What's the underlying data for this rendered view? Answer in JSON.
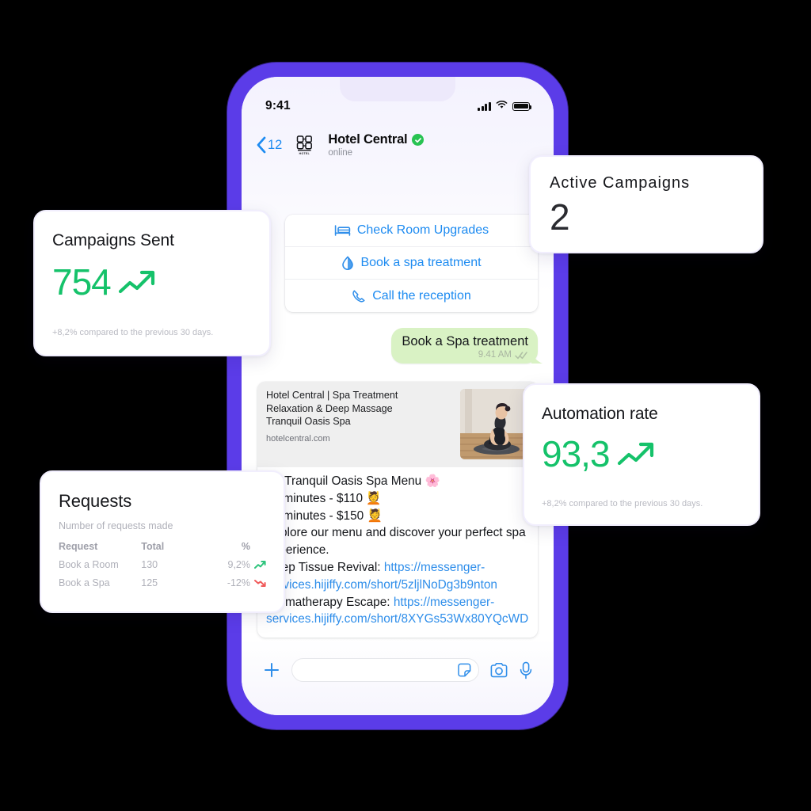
{
  "phone": {
    "statusbar": {
      "time": "9:41",
      "signal_icon": "cellular-bars-icon",
      "wifi_icon": "wifi-icon",
      "battery_icon": "battery-icon"
    },
    "header": {
      "back_icon": "chevron-left-icon",
      "back_count": "12",
      "avatar_icon": "hotel-logo-icon",
      "avatar_word": "HOTEL",
      "peer_name": "Hotel Central",
      "verified_icon": "verified-check-icon",
      "status": "online"
    },
    "quick_replies": [
      {
        "icon": "bed-icon",
        "label": "Check Room Upgrades"
      },
      {
        "icon": "water-drop-icon",
        "label": "Book a spa treatment"
      },
      {
        "icon": "phone-call-icon",
        "label": "Call the reception"
      }
    ],
    "outgoing_message": {
      "text": "Book a Spa treatment",
      "time": "9.41 AM",
      "read_receipt_icon": "double-check-icon",
      "bubble_color": "#D9F2C4"
    },
    "incoming_message": {
      "link_preview": {
        "title_lines": [
          "Hotel Central | Spa Treatment",
          "Relaxation & Deep Massage",
          "Tranquil Oasis Spa"
        ],
        "domain": "hotelcentral.com",
        "thumbnail_icon": "yoga-meditation-photo"
      },
      "body_lines": [
        {
          "text": "🌸 Tranquil Oasis Spa Menu 🌸",
          "type": "plain"
        },
        {
          "text": "60 minutes - $110 💆",
          "type": "plain"
        },
        {
          "text": "90 minutes - $150 💆",
          "type": "plain"
        },
        {
          "text": "Explore our menu and discover",
          "type": "plain"
        },
        {
          "text": "your perfect spa experience.",
          "type": "plain"
        },
        {
          "text": "Deep Tissue Revival: ",
          "type": "plain"
        },
        {
          "text": "https://messenger-services.hijiffy.com/short/5zljlNoDg3b9nton",
          "type": "link"
        },
        {
          "text": "Aromatherapy Escape: ",
          "type": "plain"
        },
        {
          "text": "https://messenger-services.hijiffy.com/short/8XYGs53Wx80YQcWD",
          "type": "link"
        }
      ]
    },
    "composer": {
      "plus_icon": "plus-icon",
      "input_placeholder": "",
      "input_value": "",
      "sticker_icon": "sticker-icon",
      "camera_icon": "camera-icon",
      "mic_icon": "microphone-icon"
    }
  },
  "cards": {
    "campaigns_sent": {
      "title": "Campaigns Sent",
      "value": "754",
      "trend_icon": "trend-up-arrow-icon",
      "footnote": "+8,2% compared to the previous 30 days."
    },
    "active_campaigns": {
      "title": "Active Campaigns",
      "value": "2"
    },
    "automation_rate": {
      "title": "Automation rate",
      "value": "93,3",
      "trend_icon": "trend-up-arrow-icon",
      "footnote": "+8,2% compared to the previous 30 days."
    },
    "requests": {
      "title": "Requests",
      "subtitle": "Number of requests made",
      "columns": [
        "Request",
        "Total",
        "%"
      ],
      "rows": [
        {
          "request": "Book a Room",
          "total": "130",
          "pct": "9,2%",
          "trend": "up"
        },
        {
          "request": "Book a Spa",
          "total": "125",
          "pct": "-12%",
          "trend": "down"
        }
      ]
    }
  },
  "colors": {
    "phone_frame_purple": "#5B3CE8",
    "accent_green": "#15C26A",
    "link_blue": "#2F8EEA",
    "action_blue": "#1D8BF1",
    "bubble_green": "#D9F2C4",
    "trend_down_red": "#F05A5A"
  }
}
